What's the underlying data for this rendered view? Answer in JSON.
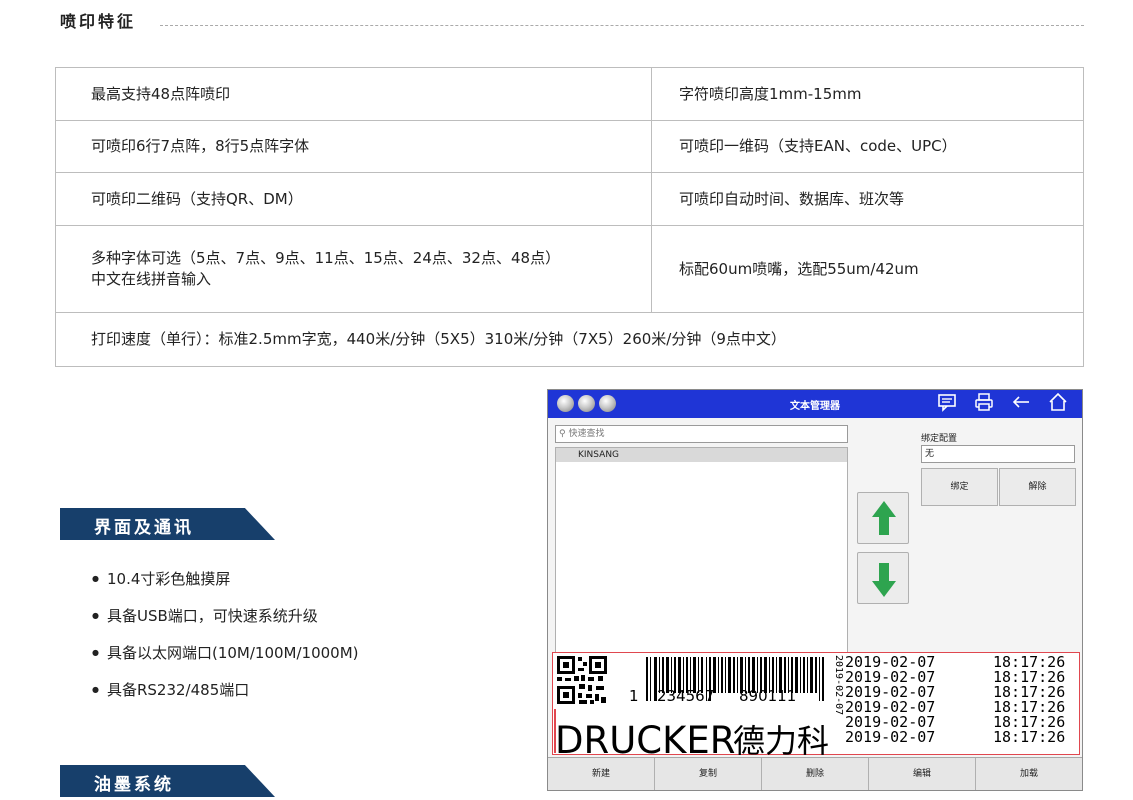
{
  "section": {
    "title": "喷印特征"
  },
  "features": {
    "rows": [
      [
        "最高支持48点阵喷印",
        "字符喷印高度1mm-15mm"
      ],
      [
        "可喷印6行7点阵，8行5点阵字体",
        "可喷印一维码（支持EAN、code、UPC）"
      ],
      [
        "可喷印二维码（支持QR、DM）",
        "可喷印自动时间、数据库、班次等"
      ],
      [
        "多种字体可选（5点、7点、9点、11点、15点、24点、32点、48点）",
        "标配60um喷嘴，选配55um/42um"
      ],
      [
        "中文在线拼音输入"
      ],
      [
        "打印速度（单行）：标准2.5mm字宽，440米/分钟（5X5）310米/分钟（7X5）260米/分钟（9点中文）"
      ]
    ]
  },
  "interface": {
    "title": "界面及通讯",
    "bullets": [
      "10.4寸彩色触摸屏",
      "具备USB端口，可快速系统升级",
      "具备以太网端口(10M/100M/1000M)",
      "具备RS232/485端口"
    ]
  },
  "ink": {
    "title": "油墨系统"
  },
  "device": {
    "title": "文本管理器",
    "icons": [
      "message-icon",
      "printer-icon",
      "back-arrow-icon",
      "home-icon"
    ],
    "search_placeholder": "快速查找",
    "list": [
      "KINSANG"
    ],
    "bind_label": "绑定配置",
    "bind_value": "无",
    "bind_button": "绑定",
    "unbind_button": "解除",
    "preview": {
      "barcode_number_left": "1",
      "barcode_number_mid": "234567",
      "barcode_number_right": "890111",
      "vertical_text": "2019-02-07",
      "date_lines": [
        "2019-02-07",
        "2019-02-07",
        "2019-02-07",
        "2019-02-07",
        "2019-02-07",
        "2019-02-07"
      ],
      "time_lines": [
        "18:17:26",
        "18:17:26",
        "18:17:26",
        "18:17:26",
        "18:17:26",
        "18:17:26"
      ],
      "brand_text": "DRUCKER",
      "cn_text": "德力科"
    },
    "bottom_buttons": [
      "新建",
      "复制",
      "删除",
      "编辑",
      "加载"
    ],
    "colors": {
      "titlebar": "#1f35d6",
      "arrow_green": "#2ea44f"
    }
  },
  "colors": {
    "banner": "#173f6b"
  }
}
